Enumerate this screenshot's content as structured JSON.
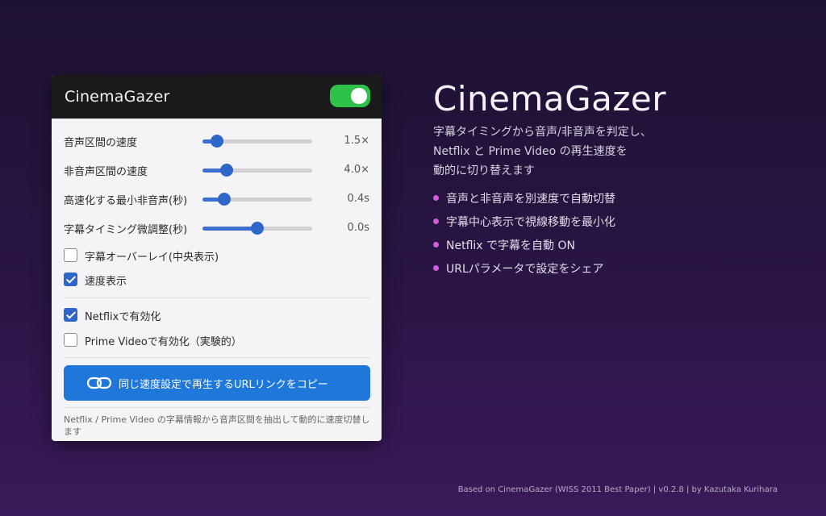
{
  "popup": {
    "title": "CinemaGazer",
    "enabled": true,
    "sliders": [
      {
        "label": "音声区間の速度",
        "value": "1.5×",
        "fraction": 0.13
      },
      {
        "label": "非音声区間の速度",
        "value": "4.0×",
        "fraction": 0.22
      },
      {
        "label": "高速化する最小非音声(秒)",
        "value": "0.4s",
        "fraction": 0.2
      },
      {
        "label": "字幕タイミング微調整(秒)",
        "value": "0.0s",
        "fraction": 0.5
      }
    ],
    "checkboxes": [
      {
        "label": "字幕オーバーレイ(中央表示)",
        "checked": false
      },
      {
        "label": "速度表示",
        "checked": true
      },
      {
        "label": "Netflixで有効化",
        "checked": true
      },
      {
        "label": "Prime Videoで有効化（実験的）",
        "checked": false
      }
    ],
    "copy_button": {
      "label": "同じ速度設定で再生するURLリンクをコピー",
      "icon": "link-icon"
    },
    "note": "Netflix / Prime Video の字幕情報から音声区間を抽出して動的に速度切替します"
  },
  "hero": {
    "title": "CinemaGazer",
    "description": [
      "字幕タイミングから音声/非音声を判定し、",
      "Netflix と Prime Video の再生速度を",
      "動的に切り替えます"
    ],
    "features": [
      "音声と非音声を別速度で自動切替",
      "字幕中心表示で視線移動を最小化",
      "Netflix で字幕を自動 ON",
      "URLパラメータで設定をシェア"
    ]
  },
  "footer": "Based on CinemaGazer (WISS 2011 Best Paper)  |  v0.2.8  |  by Kazutaka Kurihara",
  "colors": {
    "accent": "#2f66c9",
    "toggle_on": "#2ec24a",
    "button": "#1f78d9",
    "bullet": "#d35cdc"
  }
}
